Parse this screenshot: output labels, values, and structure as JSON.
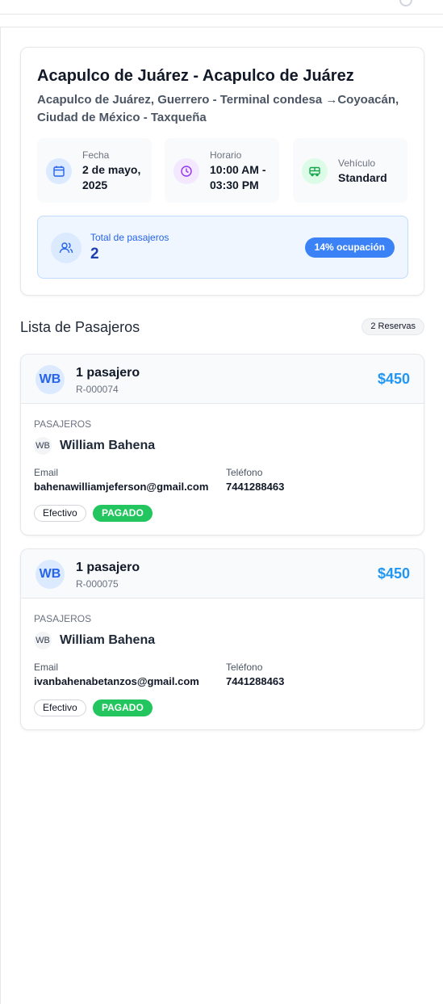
{
  "trip": {
    "title": "Acapulco de Juárez - Acapulco de Juárez",
    "route": "Acapulco de Juárez, Guerrero - Terminal condesa →Coyoacán, Ciudad de México - Taxqueña",
    "date_label": "Fecha",
    "date_value": "2 de mayo, 2025",
    "time_label": "Horario",
    "time_value": "10:00 AM - 03:30 PM",
    "vehicle_label": "Vehículo",
    "vehicle_value": "Standard",
    "passengers_label": "Total de pasajeros",
    "passengers_value": "2",
    "occupancy": "14% ocupación"
  },
  "list": {
    "title": "Lista de Pasajeros",
    "count_badge": "2 Reservas"
  },
  "reservations": [
    {
      "avatar": "WB",
      "count": "1 pasajero",
      "code": "R-000074",
      "price": "$450",
      "section_label": "PASAJEROS",
      "pax_avatar": "WB",
      "pax_name": "William Bahena",
      "email_label": "Email",
      "email": "bahenawilliamjeferson@gmail.com",
      "phone_label": "Teléfono",
      "phone": "7441288463",
      "method": "Efectivo",
      "status": "PAGADO"
    },
    {
      "avatar": "WB",
      "count": "1 pasajero",
      "code": "R-000075",
      "price": "$450",
      "section_label": "PASAJEROS",
      "pax_avatar": "WB",
      "pax_name": "William Bahena",
      "email_label": "Email",
      "email": "ivanbahenabetanzos@gmail.com",
      "phone_label": "Teléfono",
      "phone": "7441288463",
      "method": "Efectivo",
      "status": "PAGADO"
    }
  ],
  "icons": {
    "date": "calendar-icon",
    "time": "clock-icon",
    "vehicle": "bus-icon",
    "passengers": "users-icon"
  },
  "colors": {
    "accent": "#3b82f6",
    "price": "#2196f3",
    "paid": "#22c55e"
  }
}
